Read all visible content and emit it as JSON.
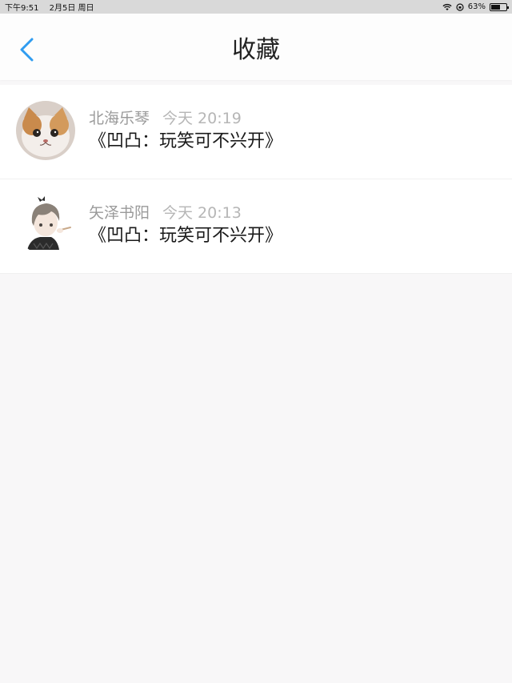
{
  "status_bar": {
    "time": "下午9:51",
    "date": "2月5日 周日",
    "battery": "63%",
    "battery_level": 0.63
  },
  "nav": {
    "title": "收藏"
  },
  "items": [
    {
      "author": "北海乐琴",
      "time": "今天 20:19",
      "title": "《凹凸：玩笑可不兴开》",
      "avatar": "cat-avatar"
    },
    {
      "author": "矢泽书阳",
      "time": "今天 20:13",
      "title": "《凹凸：玩笑可不兴开》",
      "avatar": "anime-boy-avatar"
    }
  ],
  "colors": {
    "accent": "#2f9cf0",
    "background": "#f8f7f8"
  }
}
